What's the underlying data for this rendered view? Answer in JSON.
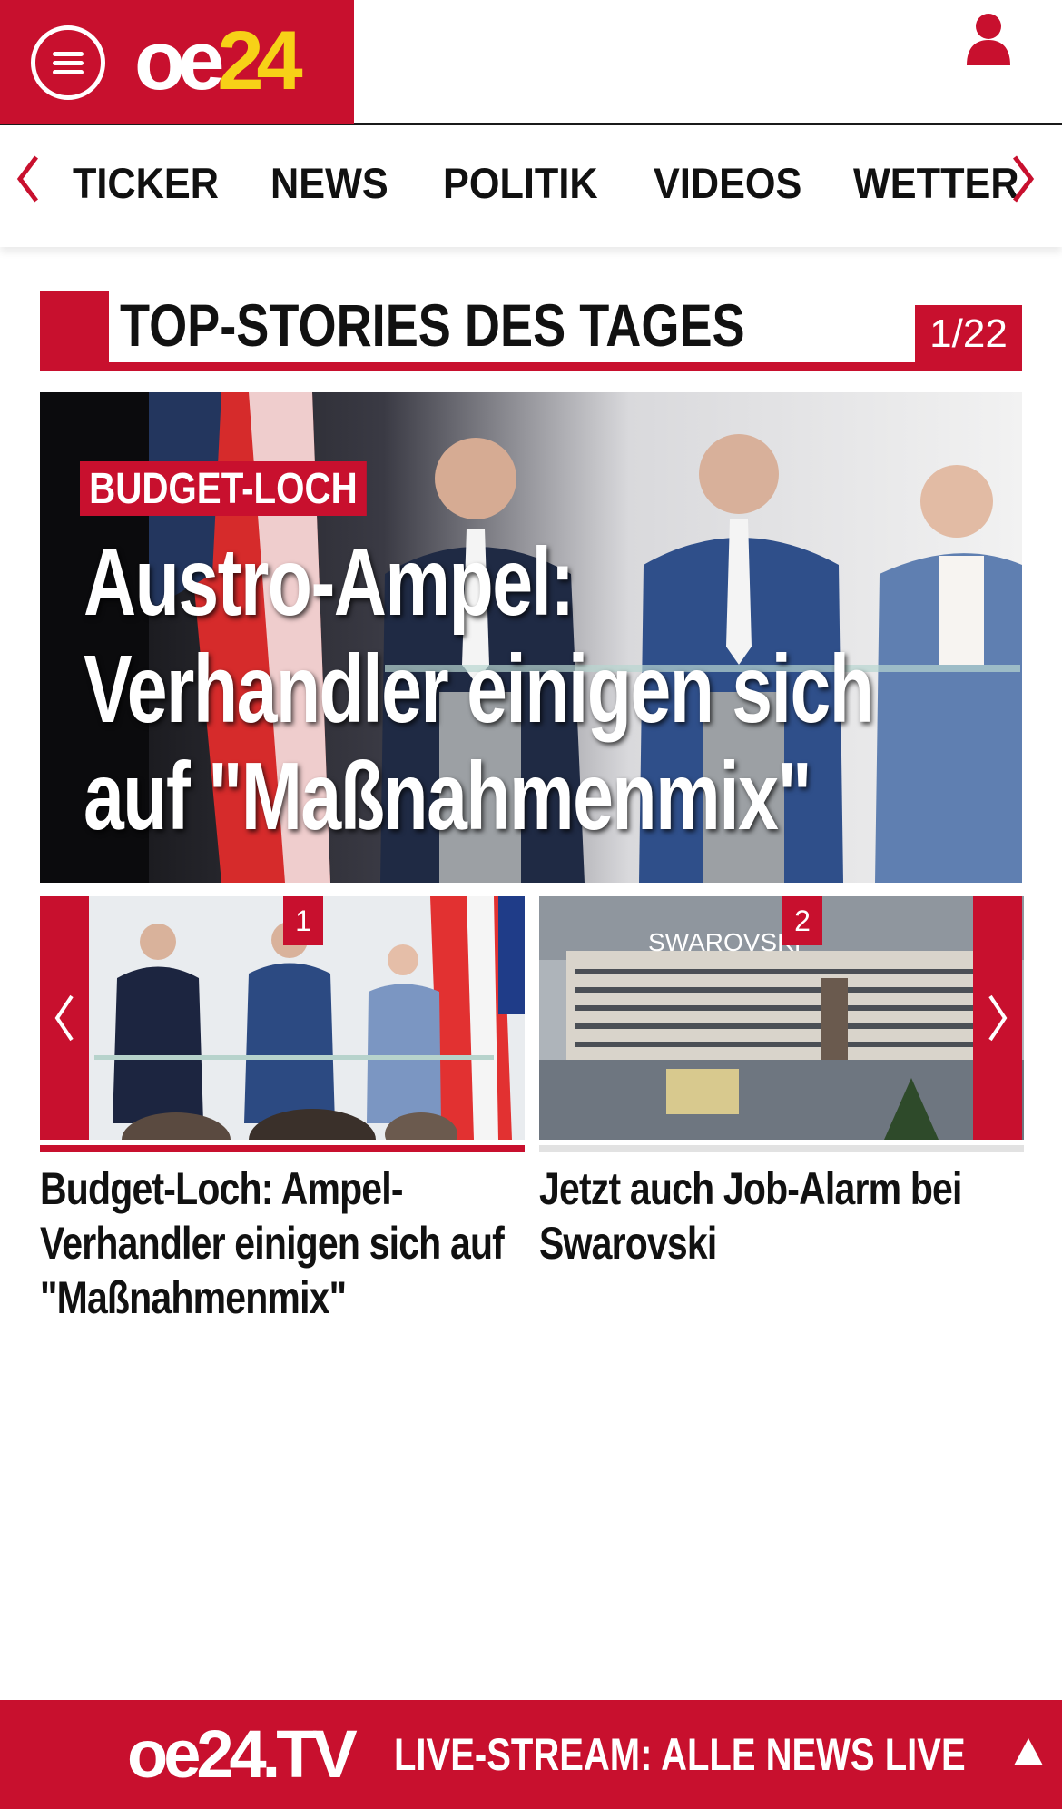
{
  "header": {
    "logo": {
      "oe": "oe",
      "num": "24"
    },
    "menu_icon": "hamburger-menu-icon",
    "user_icon": "user-icon"
  },
  "nav": {
    "items": [
      {
        "label": "TICKER"
      },
      {
        "label": "NEWS"
      },
      {
        "label": "POLITIK"
      },
      {
        "label": "VIDEOS"
      },
      {
        "label": "WETTER"
      }
    ],
    "prev_icon": "chevron-left-icon",
    "next_icon": "chevron-right-icon"
  },
  "top_stories": {
    "title": "TOP-STORIES DES TAGES",
    "counter": "1/22",
    "hero": {
      "kicker": "BUDGET-LOCH",
      "headline": "Austro-Ampel: Verhandler einigen sich auf \"Maßnahmenmix\""
    },
    "cards": [
      {
        "number": "1",
        "title": "Budget-Loch: Ampel-Verhandler einigen sich auf \"Maßnahmenmix\""
      },
      {
        "number": "2",
        "title": "Jetzt auch Job-Alarm bei Swarovski"
      }
    ]
  },
  "footer": {
    "logo": "oe24.TV",
    "text": "LIVE-STREAM:  ALLE NEWS LIVE",
    "scroll_top_icon": "triangle-up-icon"
  },
  "colors": {
    "brand_red": "#c8102e",
    "logo_yellow": "#f7d117",
    "text": "#111111"
  }
}
